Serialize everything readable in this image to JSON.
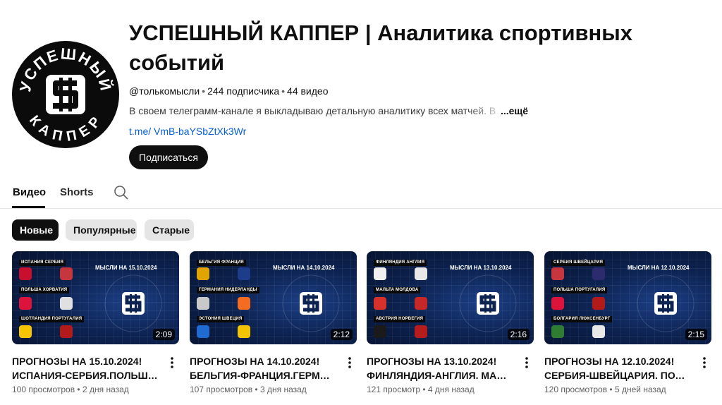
{
  "channel": {
    "title": "УСПЕШНЫЙ КАППЕР | Аналитика спортивных событий",
    "handle": "@толькомысли",
    "subscribers": "244 подписчика",
    "video_count": "44 видео",
    "description": "В своем телеграмм-канале я выкладываю детальную аналитику всех матчей. В наш",
    "more_label": "...ещё",
    "link": "t.me/ VmB-baYSbZtXk3Wr",
    "subscribe_label": "Подписаться",
    "avatar_text_top": "УСПЕШНЫЙ",
    "avatar_text_bottom": "КАППЕР"
  },
  "tabs": [
    {
      "label": "Видео",
      "active": true
    },
    {
      "label": "Shorts",
      "active": false
    }
  ],
  "chips": [
    {
      "label": "Новые",
      "active": true
    },
    {
      "label": "Популярные",
      "active": false
    },
    {
      "label": "Старые",
      "active": false
    }
  ],
  "videos": [
    {
      "title_line1": "ПРОГНОЗЫ НА 15.10.2024!",
      "title_line2": "ИСПАНИЯ-СЕРБИЯ.ПОЛЬША-...",
      "views": "100 просмотров",
      "age": "2 дня назад",
      "duration": "2:09",
      "banner": "МЫСЛИ НА 15.10.2024",
      "pairs": [
        {
          "label": "ИСПАНИЯ   СЕРБИЯ",
          "home": "#c8102e",
          "away": "#c6363c"
        },
        {
          "label": "ПОЛЬША   ХОРВАТИЯ",
          "home": "#dc143c",
          "away": "#e0e0e0"
        },
        {
          "label": "ШОТЛАНДИЯ   ПОРТУГАЛИЯ",
          "home": "#f7c600",
          "away": "#b31b1b"
        }
      ]
    },
    {
      "title_line1": "ПРОГНОЗЫ НА 14.10.2024!",
      "title_line2": "БЕЛЬГИЯ-ФРАНЦИЯ.ГЕРМАНИЯ-...",
      "views": "107 просмотров",
      "age": "3 дня назад",
      "duration": "2:12",
      "banner": "МЫСЛИ НА 14.10.2024",
      "pairs": [
        {
          "label": "БЕЛЬГИЯ   ФРАНЦИЯ",
          "home": "#e2a400",
          "away": "#1e3c8c"
        },
        {
          "label": "ГЕРМАНИЯ   НИДЕРЛАНДЫ",
          "home": "#c9c9c9",
          "away": "#f36c21"
        },
        {
          "label": "ЭСТОНИЯ   ШВЕЦИЯ",
          "home": "#1f6bd1",
          "away": "#f2c500"
        }
      ]
    },
    {
      "title_line1": "ПРОГНОЗЫ НА 13.10.2024!",
      "title_line2": "ФИНЛЯНДИЯ-АНГЛИЯ. МАЛЬТА-...",
      "views": "121 просмотр",
      "age": "4 дня назад",
      "duration": "2:16",
      "banner": "МЫСЛИ НА 13.10.2024",
      "pairs": [
        {
          "label": "ФИНЛЯНДИЯ   АНГЛИЯ",
          "home": "#f0f0f0",
          "away": "#e8e8e8"
        },
        {
          "label": "МАЛЬТА   МОЛДОВА",
          "home": "#d6312b",
          "away": "#c62828"
        },
        {
          "label": "АВСТРИЯ   НОРВЕГИЯ",
          "home": "#1a1a1a",
          "away": "#b71c1c"
        }
      ]
    },
    {
      "title_line1": "ПРОГНОЗЫ НА 12.10.2024!",
      "title_line2": "СЕРБИЯ-ШВЕЙЦАРИЯ. ПОЛЬША...",
      "views": "120 просмотров",
      "age": "5 дней назад",
      "duration": "2:15",
      "banner": "МЫСЛИ НА 12.10.2024",
      "pairs": [
        {
          "label": "СЕРБИЯ   ШВЕЙЦАРИЯ",
          "home": "#c6363c",
          "away": "#2b2b6e"
        },
        {
          "label": "ПОЛЬША   ПОРТУГАЛИЯ",
          "home": "#dc143c",
          "away": "#b31b1b"
        },
        {
          "label": "БОЛГАРИЯ   ЛЮКСЕНБУРГ",
          "home": "#2e7d32",
          "away": "#e8e8e8"
        }
      ]
    }
  ]
}
